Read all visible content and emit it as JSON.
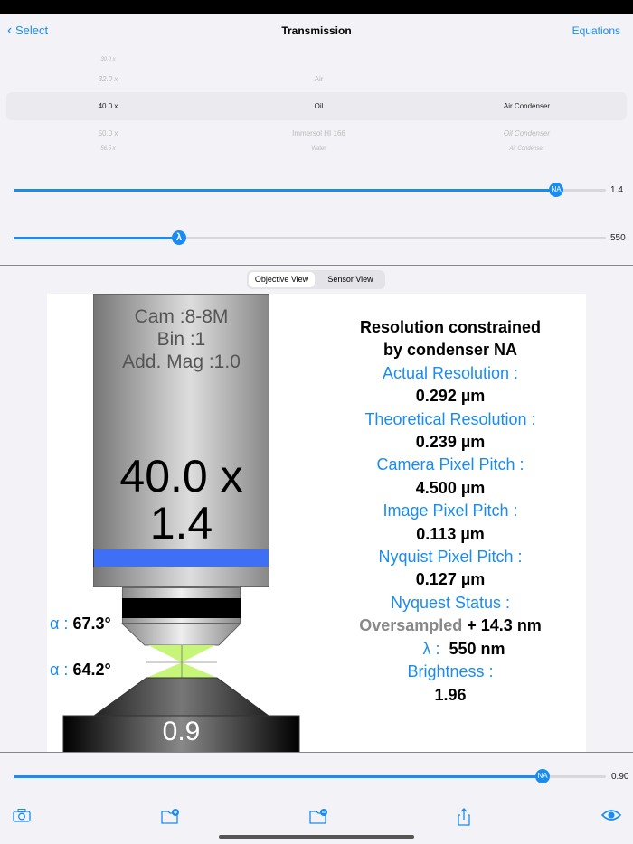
{
  "nav": {
    "back": "Select",
    "title": "Transmission",
    "right": "Equations"
  },
  "picker": {
    "col1": [
      "30.0 x",
      "32.0 x",
      "40.0 x",
      "50.0 x",
      "56.5 x"
    ],
    "col2": [
      "Air",
      "Oil",
      "Immersol HI 166",
      "Water"
    ],
    "col3": [
      "Air Condenser",
      "Oil Condenser",
      "Air Condenser"
    ]
  },
  "sliders": {
    "na": {
      "label": "NA",
      "value": "1.4",
      "fraction": 0.96
    },
    "lambda": {
      "label": "λ",
      "value": "550",
      "fraction": 0.28
    },
    "condenser_na": {
      "label": "NA",
      "value": "0.90",
      "fraction": 0.9
    }
  },
  "segments": [
    "Objective View",
    "Sensor View"
  ],
  "objective": {
    "cam": "Cam :8-8M",
    "bin": "Bin :1",
    "addmag": "Add. Mag :1.0",
    "mag": "40.0 x",
    "na": "1.4",
    "cond_na": "0.9",
    "alpha_label": "α :",
    "alpha1": "67.3°",
    "alpha2": "64.2°"
  },
  "info": {
    "heading1": "Resolution constrained",
    "heading2": "by condenser NA",
    "actual_label": "Actual Resolution :",
    "actual": "0.292 µm",
    "theo_label": "Theoretical Resolution :",
    "theo": "0.239 µm",
    "cam_label": "Camera Pixel Pitch :",
    "cam": "4.500 µm",
    "img_label": "Image Pixel Pitch :",
    "img": "0.113 µm",
    "nyq_label": "Nyquist Pixel Pitch :",
    "nyq": "0.127 µm",
    "status_label": "Nyquest Status :",
    "status": "Oversampled",
    "status_extra": "+ 14.3 nm",
    "lambda_label": "λ :",
    "lambda": "550 nm",
    "bright_label": "Brightness :",
    "bright": "1.96"
  },
  "colors": {
    "accent": "#1a8cf0",
    "band": "#3f6ff5",
    "cone": "#c6f57a"
  }
}
